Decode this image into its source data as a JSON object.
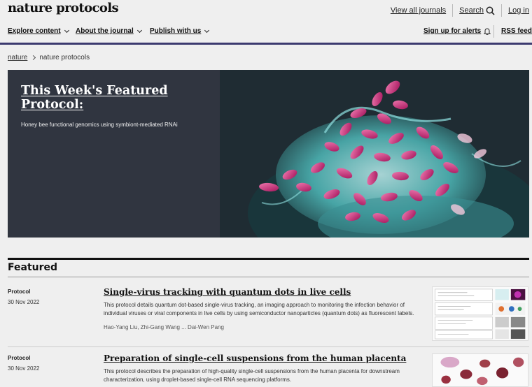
{
  "header": {
    "logo": "nature protocols",
    "view_all_journals": "View all journals",
    "search_label": "Search",
    "login_label": "Log in"
  },
  "nav": {
    "explore": "Explore content",
    "about": "About the journal",
    "publish": "Publish with us",
    "alerts": "Sign up for alerts",
    "rss": "RSS feed"
  },
  "breadcrumb": {
    "root": "nature",
    "current": "nature protocols"
  },
  "hero": {
    "title": "This Week's Featured Protocol:",
    "subtitle": "Honey bee functional genomics using symbiont-mediated RNAi"
  },
  "featured": {
    "heading": "Featured",
    "articles": [
      {
        "type": "Protocol",
        "date": "30 Nov 2022",
        "title": "Single-virus tracking with quantum dots in live cells",
        "description": "This protocol details quantum dot-based single-virus tracking, an imaging approach to monitoring the infection behavior of individual viruses or viral components in live cells by using semiconductor nanoparticles (quantum dots) as fluorescent labels.",
        "authors": "Hao-Yang Liu, Zhi-Gang Wang ... Dai-Wen Pang"
      },
      {
        "type": "Protocol",
        "date": "30 Nov 2022",
        "title": "Preparation of single-cell suspensions from the human placenta",
        "description": "This protocol describes the preparation of high-quality single-cell suspensions from the human placenta for downstream characterization, using droplet-based single-cell RNA sequencing platforms."
      }
    ]
  },
  "colors": {
    "accent_rule": "#3c3a6f",
    "hero_bg": "#303540",
    "bacteria": "#d0307a",
    "cell_cyan": "#4fc4c0"
  }
}
